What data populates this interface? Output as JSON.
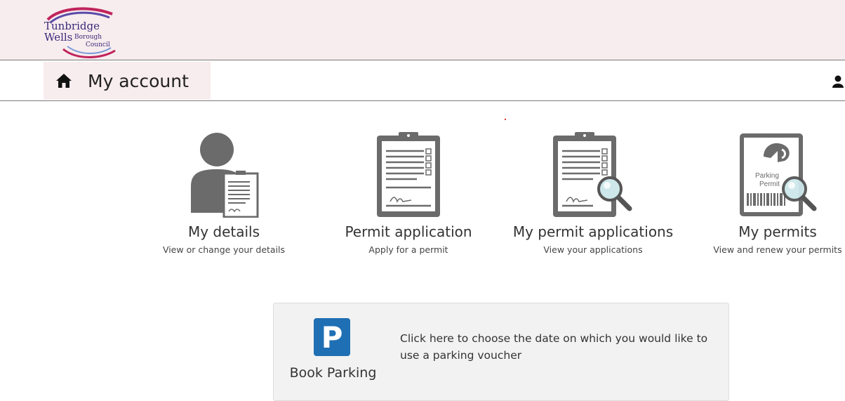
{
  "header": {
    "logo": {
      "line1": "Tunbridge",
      "line2": "Wells",
      "line3": "Borough",
      "line4": "Council"
    }
  },
  "nav": {
    "title": "My account",
    "home_icon": "home-icon",
    "user_icon": "user-icon"
  },
  "tiles": [
    {
      "title": "My details",
      "subtitle": "View or change your details",
      "icon": "person-clipboard-icon"
    },
    {
      "title": "Permit application",
      "subtitle": "Apply for a permit",
      "icon": "clipboard-form-icon"
    },
    {
      "title": "My permit applications",
      "subtitle": "View your applications",
      "icon": "clipboard-search-icon"
    },
    {
      "title": "My permits",
      "subtitle": "View and renew your permits",
      "icon": "parking-permit-search-icon",
      "graphic_text_1": "Parking",
      "graphic_text_2": "Permit"
    }
  ],
  "booking": {
    "sign": "P",
    "label": "Book Parking",
    "description": "Click here to choose the date on which you would like to use a parking voucher"
  },
  "colors": {
    "header_bg": "#f7ecee",
    "parking_blue": "#1f6fb4",
    "icon_grey": "#6b6b6b"
  }
}
